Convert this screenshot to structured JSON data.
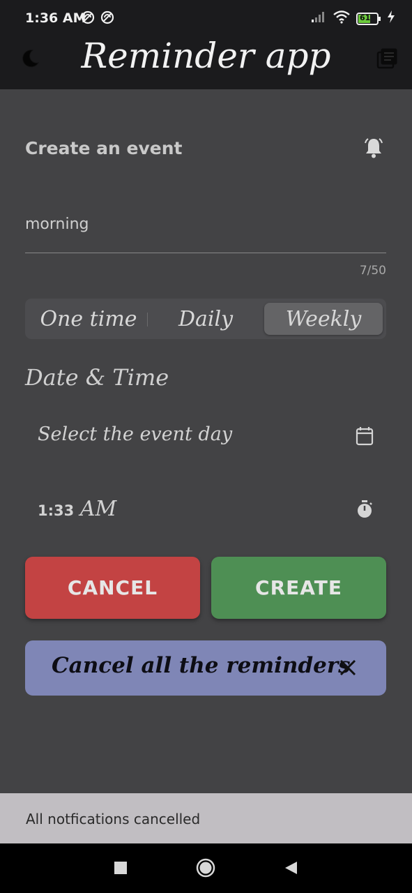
{
  "status_bar": {
    "time": "1:36 AM",
    "battery_level": "61",
    "icons": [
      "alert-circle-icon",
      "alert-circle-icon",
      "signal-icon",
      "wifi-icon",
      "battery-icon",
      "charging-icon"
    ]
  },
  "app_bar": {
    "title": "Reminder app",
    "left_icon": "moon-icon",
    "right_icon": "library-icon"
  },
  "form": {
    "heading": "Create an event",
    "heading_icon": "bell-ring-icon",
    "event_name_value": "morning",
    "counter": "7/50",
    "frequency_options": [
      "One time",
      "Daily",
      "Weekly"
    ],
    "frequency_selected": "Weekly",
    "section_title": "Date & Time",
    "date_placeholder": "Select the event day",
    "date_icon": "calendar-icon",
    "time_value": "1:33 AM",
    "time_digits": "1:33",
    "time_meridiem": "AM",
    "time_icon": "stopwatch-icon"
  },
  "actions": {
    "cancel_label": "CANCEL",
    "create_label": "CREATE",
    "cancel_color": "#c34343",
    "create_color": "#4e8f54"
  },
  "cancel_all": {
    "label": "Cancel all the reminders",
    "icon": "close-icon",
    "color": "#7f86b6"
  },
  "snackbar": {
    "message": "All notfications cancelled"
  },
  "nav_bar": {
    "icons": [
      "recents-icon",
      "home-icon",
      "back-icon"
    ]
  },
  "colors": {
    "background": "#434345",
    "app_bar": "#1b1b1d"
  }
}
